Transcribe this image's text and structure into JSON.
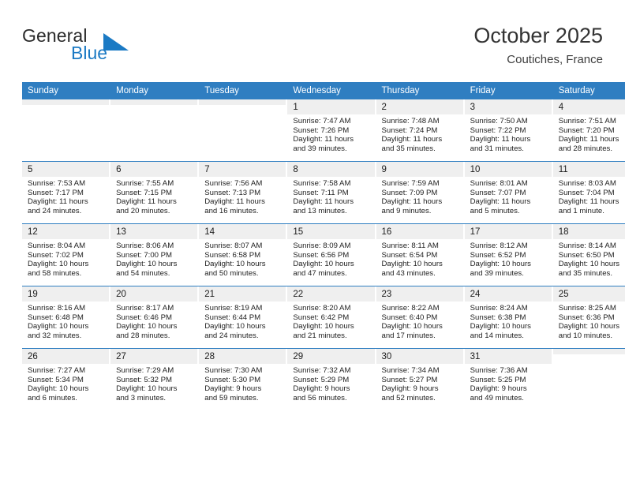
{
  "brand": {
    "name_top": "General",
    "name_bottom": "Blue",
    "accent_color": "#1b7ac4",
    "triangle_icon": "triangle-icon"
  },
  "header": {
    "title": "October 2025",
    "location": "Coutiches, France"
  },
  "calendar": {
    "header_bg": "#2f7ec1",
    "daynum_bg": "#efefef",
    "weekdays": [
      "Sunday",
      "Monday",
      "Tuesday",
      "Wednesday",
      "Thursday",
      "Friday",
      "Saturday"
    ],
    "weeks": [
      [
        {
          "day": "",
          "empty": true,
          "lines": []
        },
        {
          "day": "",
          "empty": true,
          "lines": []
        },
        {
          "day": "",
          "empty": true,
          "lines": []
        },
        {
          "day": "1",
          "lines": [
            "Sunrise: 7:47 AM",
            "Sunset: 7:26 PM",
            "Daylight: 11 hours",
            "and 39 minutes."
          ]
        },
        {
          "day": "2",
          "lines": [
            "Sunrise: 7:48 AM",
            "Sunset: 7:24 PM",
            "Daylight: 11 hours",
            "and 35 minutes."
          ]
        },
        {
          "day": "3",
          "lines": [
            "Sunrise: 7:50 AM",
            "Sunset: 7:22 PM",
            "Daylight: 11 hours",
            "and 31 minutes."
          ]
        },
        {
          "day": "4",
          "lines": [
            "Sunrise: 7:51 AM",
            "Sunset: 7:20 PM",
            "Daylight: 11 hours",
            "and 28 minutes."
          ]
        }
      ],
      [
        {
          "day": "5",
          "lines": [
            "Sunrise: 7:53 AM",
            "Sunset: 7:17 PM",
            "Daylight: 11 hours",
            "and 24 minutes."
          ]
        },
        {
          "day": "6",
          "lines": [
            "Sunrise: 7:55 AM",
            "Sunset: 7:15 PM",
            "Daylight: 11 hours",
            "and 20 minutes."
          ]
        },
        {
          "day": "7",
          "lines": [
            "Sunrise: 7:56 AM",
            "Sunset: 7:13 PM",
            "Daylight: 11 hours",
            "and 16 minutes."
          ]
        },
        {
          "day": "8",
          "lines": [
            "Sunrise: 7:58 AM",
            "Sunset: 7:11 PM",
            "Daylight: 11 hours",
            "and 13 minutes."
          ]
        },
        {
          "day": "9",
          "lines": [
            "Sunrise: 7:59 AM",
            "Sunset: 7:09 PM",
            "Daylight: 11 hours",
            "and 9 minutes."
          ]
        },
        {
          "day": "10",
          "lines": [
            "Sunrise: 8:01 AM",
            "Sunset: 7:07 PM",
            "Daylight: 11 hours",
            "and 5 minutes."
          ]
        },
        {
          "day": "11",
          "lines": [
            "Sunrise: 8:03 AM",
            "Sunset: 7:04 PM",
            "Daylight: 11 hours",
            "and 1 minute."
          ]
        }
      ],
      [
        {
          "day": "12",
          "lines": [
            "Sunrise: 8:04 AM",
            "Sunset: 7:02 PM",
            "Daylight: 10 hours",
            "and 58 minutes."
          ]
        },
        {
          "day": "13",
          "lines": [
            "Sunrise: 8:06 AM",
            "Sunset: 7:00 PM",
            "Daylight: 10 hours",
            "and 54 minutes."
          ]
        },
        {
          "day": "14",
          "lines": [
            "Sunrise: 8:07 AM",
            "Sunset: 6:58 PM",
            "Daylight: 10 hours",
            "and 50 minutes."
          ]
        },
        {
          "day": "15",
          "lines": [
            "Sunrise: 8:09 AM",
            "Sunset: 6:56 PM",
            "Daylight: 10 hours",
            "and 47 minutes."
          ]
        },
        {
          "day": "16",
          "lines": [
            "Sunrise: 8:11 AM",
            "Sunset: 6:54 PM",
            "Daylight: 10 hours",
            "and 43 minutes."
          ]
        },
        {
          "day": "17",
          "lines": [
            "Sunrise: 8:12 AM",
            "Sunset: 6:52 PM",
            "Daylight: 10 hours",
            "and 39 minutes."
          ]
        },
        {
          "day": "18",
          "lines": [
            "Sunrise: 8:14 AM",
            "Sunset: 6:50 PM",
            "Daylight: 10 hours",
            "and 35 minutes."
          ]
        }
      ],
      [
        {
          "day": "19",
          "lines": [
            "Sunrise: 8:16 AM",
            "Sunset: 6:48 PM",
            "Daylight: 10 hours",
            "and 32 minutes."
          ]
        },
        {
          "day": "20",
          "lines": [
            "Sunrise: 8:17 AM",
            "Sunset: 6:46 PM",
            "Daylight: 10 hours",
            "and 28 minutes."
          ]
        },
        {
          "day": "21",
          "lines": [
            "Sunrise: 8:19 AM",
            "Sunset: 6:44 PM",
            "Daylight: 10 hours",
            "and 24 minutes."
          ]
        },
        {
          "day": "22",
          "lines": [
            "Sunrise: 8:20 AM",
            "Sunset: 6:42 PM",
            "Daylight: 10 hours",
            "and 21 minutes."
          ]
        },
        {
          "day": "23",
          "lines": [
            "Sunrise: 8:22 AM",
            "Sunset: 6:40 PM",
            "Daylight: 10 hours",
            "and 17 minutes."
          ]
        },
        {
          "day": "24",
          "lines": [
            "Sunrise: 8:24 AM",
            "Sunset: 6:38 PM",
            "Daylight: 10 hours",
            "and 14 minutes."
          ]
        },
        {
          "day": "25",
          "lines": [
            "Sunrise: 8:25 AM",
            "Sunset: 6:36 PM",
            "Daylight: 10 hours",
            "and 10 minutes."
          ]
        }
      ],
      [
        {
          "day": "26",
          "lines": [
            "Sunrise: 7:27 AM",
            "Sunset: 5:34 PM",
            "Daylight: 10 hours",
            "and 6 minutes."
          ]
        },
        {
          "day": "27",
          "lines": [
            "Sunrise: 7:29 AM",
            "Sunset: 5:32 PM",
            "Daylight: 10 hours",
            "and 3 minutes."
          ]
        },
        {
          "day": "28",
          "lines": [
            "Sunrise: 7:30 AM",
            "Sunset: 5:30 PM",
            "Daylight: 9 hours",
            "and 59 minutes."
          ]
        },
        {
          "day": "29",
          "lines": [
            "Sunrise: 7:32 AM",
            "Sunset: 5:29 PM",
            "Daylight: 9 hours",
            "and 56 minutes."
          ]
        },
        {
          "day": "30",
          "lines": [
            "Sunrise: 7:34 AM",
            "Sunset: 5:27 PM",
            "Daylight: 9 hours",
            "and 52 minutes."
          ]
        },
        {
          "day": "31",
          "lines": [
            "Sunrise: 7:36 AM",
            "Sunset: 5:25 PM",
            "Daylight: 9 hours",
            "and 49 minutes."
          ]
        },
        {
          "day": "",
          "empty": true,
          "lines": []
        }
      ]
    ]
  }
}
